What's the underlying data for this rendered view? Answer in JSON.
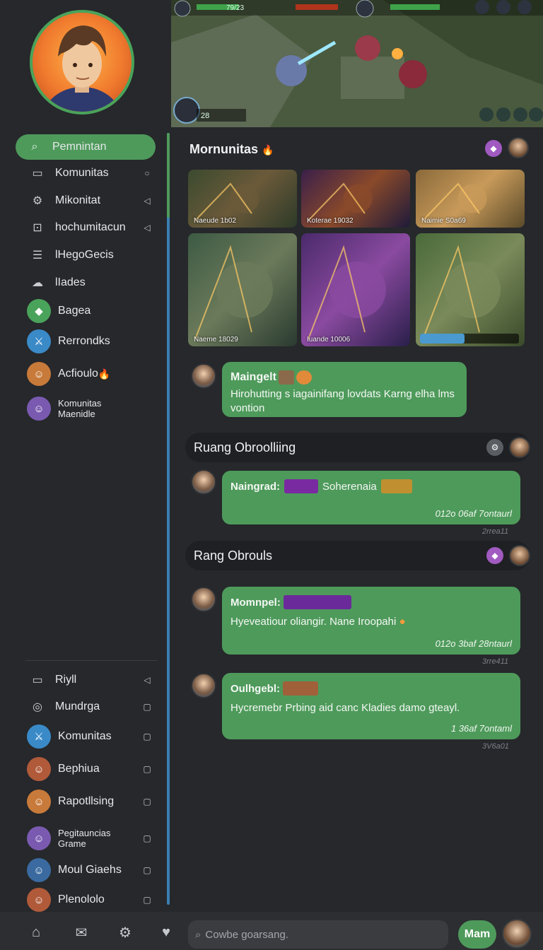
{
  "sidebar": {
    "items": [
      {
        "label": "Pemnintan",
        "icon": "search-icon",
        "glyph": "⌕",
        "active": true,
        "trail": ""
      },
      {
        "label": "Komunitas",
        "icon": "board-icon",
        "glyph": "▭",
        "trail": "○"
      },
      {
        "label": "Mikonitat",
        "icon": "gear-icon",
        "glyph": "⚙",
        "trail": "◁"
      },
      {
        "label": "hochumitacun",
        "icon": "lock-icon",
        "glyph": "⊡",
        "trail": "◁"
      },
      {
        "label": "lHegoGecis",
        "icon": "card-icon",
        "glyph": "☰",
        "trail": ""
      },
      {
        "label": "lIades",
        "icon": "cloud-icon",
        "glyph": "☁",
        "trail": ""
      },
      {
        "label": "Bagea",
        "icon": "green-badge-icon",
        "glyph": "◆",
        "trail": ""
      },
      {
        "label": "Rerrondks",
        "icon": "sword-avatar-icon",
        "glyph": "⚔",
        "trail": ""
      },
      {
        "label": "Acfioulo",
        "icon": "hero-avatar-icon",
        "glyph": "☺",
        "trail": "",
        "badge": "🔥"
      },
      {
        "label": "Komunitas Maenidle",
        "icon": "hero-avatar-icon",
        "glyph": "☺",
        "trail": "",
        "small": true
      }
    ],
    "lower_items": [
      {
        "label": "Riyll",
        "icon": "card-icon",
        "glyph": "▭",
        "trail": "◁"
      },
      {
        "label": "Mundrga",
        "icon": "camera-icon",
        "glyph": "◎",
        "trail": "▢"
      },
      {
        "label": "Komunitas",
        "icon": "sword-avatar-icon",
        "glyph": "⚔",
        "trail": "▢"
      },
      {
        "label": "Bephiua",
        "icon": "hero-avatar-icon",
        "glyph": "☺",
        "trail": "▢"
      },
      {
        "label": "Rapotllsing",
        "icon": "hero-avatar-icon",
        "glyph": "☺",
        "trail": "▢"
      },
      {
        "label": "Pegitauncias Grame",
        "icon": "hero-avatar-icon",
        "glyph": "☺",
        "trail": "▢",
        "small": true
      },
      {
        "label": "Moul Giaehs",
        "icon": "hero-avatar-icon",
        "glyph": "☺",
        "trail": "▢"
      },
      {
        "label": "Plenololo",
        "icon": "hero-avatar-icon",
        "glyph": "☺",
        "trail": "▢"
      }
    ]
  },
  "banner": {
    "hud_left": "79/23",
    "hud_bottom": "28"
  },
  "gallery": {
    "title": "Mornunitas",
    "title_badge": "🔥",
    "tiles": [
      {
        "caption": "Naeude 1b02",
        "palette": [
          "#3b4a2f",
          "#6b5a3a",
          "#2d3a28"
        ]
      },
      {
        "caption": "Koterae 19032",
        "palette": [
          "#3a1f4a",
          "#8a4a2a",
          "#1f1a3a"
        ]
      },
      {
        "caption": "Naimie S0a69",
        "palette": [
          "#8a6a3a",
          "#c89a5a",
          "#5a4a2a"
        ]
      },
      {
        "caption": "Naeme 18029",
        "palette": [
          "#3d5a44",
          "#6b7a5a",
          "#2a3a30"
        ]
      },
      {
        "caption": "Iuande 10006",
        "palette": [
          "#4a2a6a",
          "#8a4aa0",
          "#2a1f4a"
        ]
      },
      {
        "caption": "",
        "palette": [
          "#4a6a3a",
          "#7a8a5a",
          "#3a4a2a"
        ]
      }
    ]
  },
  "chat": {
    "first": {
      "name": "Maingelt",
      "text": "Hirohutting s iagainifang lovdats Karng elha lms vontion"
    },
    "room1": {
      "title": "Ruang Obroolliing",
      "message": {
        "name": "Naingrad:",
        "extra": "Soherenaia",
        "time": "012o 06af 7ontaurl",
        "stamp": "2rrea11"
      }
    },
    "room2": {
      "title": "Rang Obrouls",
      "messages": [
        {
          "name": "Momnpel:",
          "text": "Hyeveatiour oliangir. Nane Iroopahi",
          "time": "012o 3baf 28ntaurl",
          "stamp": "3rre411"
        },
        {
          "name": "Oulhgebl:",
          "text": "Hycremebr Prbing aid canc Kladies damo gteayl.",
          "time": "1  36af 7ontaml",
          "stamp": "3V6a01"
        }
      ]
    }
  },
  "bottom": {
    "search_placeholder": "Cowbe goarsang.",
    "send_label": "Mam"
  },
  "colors": {
    "accent": "#4e9a5b",
    "background": "#26282b",
    "scroll_track": "#3a7fb3"
  }
}
